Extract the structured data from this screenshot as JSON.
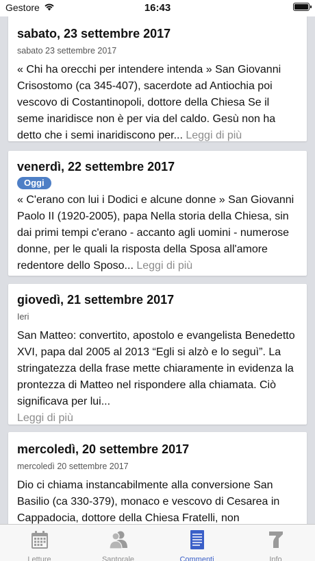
{
  "status_bar": {
    "carrier": "Gestore",
    "time": "16:43"
  },
  "cards": [
    {
      "date": "sabato, 23 settembre 2017",
      "subtitle": "sabato 23 settembre 2017",
      "text": "« Chi ha orecchi per intendere intenda » San Giovanni Crisostomo (ca 345-407), sacerdote ad Antiochia poi vescovo di Costantinopoli, dottore della Chiesa  Se il seme inaridisce non è per via del caldo. Gesù non ha detto che i semi inaridiscono per...",
      "read_more": "Leggi di più"
    },
    {
      "date": "venerdì, 22 settembre 2017",
      "badge": "Oggi",
      "text": "« C'erano con lui i Dodici e alcune donne » San Giovanni Paolo II (1920-2005), papa  Nella storia della Chiesa, sin dai primi tempi c'erano - accanto agli uomini - numerose donne, per le quali la risposta della Sposa all'amore redentore dello Sposo...",
      "read_more": "Leggi di più"
    },
    {
      "date": "giovedì, 21 settembre 2017",
      "subtitle": "Ieri",
      "text": "San Matteo: convertito, apostolo e evangelista Benedetto XVI, papa dal 2005 al 2013  “Egli si alzò e lo seguì”. La stringatezza della frase mette chiaramente in evidenza la prontezza di Matteo nel rispondere alla chiamata. Ciò significava per lui...",
      "read_more": "Leggi di più"
    },
    {
      "date": "mercoledì, 20 settembre 2017",
      "subtitle": "mercoledì 20 settembre 2017",
      "text": "Dio ci chiama instancabilmente alla conversione San Basilio (ca 330-379), monaco e vescovo di Cesarea in Cappadocia, dottore della Chiesa  Fratelli, non"
    }
  ],
  "tabs": [
    {
      "label": "Letture",
      "icon": "calendar-icon",
      "active": false
    },
    {
      "label": "Santorale",
      "icon": "people-icon",
      "active": false
    },
    {
      "label": "Commenti",
      "icon": "document-icon",
      "active": true
    },
    {
      "label": "Info",
      "icon": "info-icon",
      "active": false
    }
  ],
  "colors": {
    "accent": "#3a5fc8",
    "badge": "#4e7fc6",
    "read_more": "#8b8b8b",
    "background": "#dcdee3"
  }
}
